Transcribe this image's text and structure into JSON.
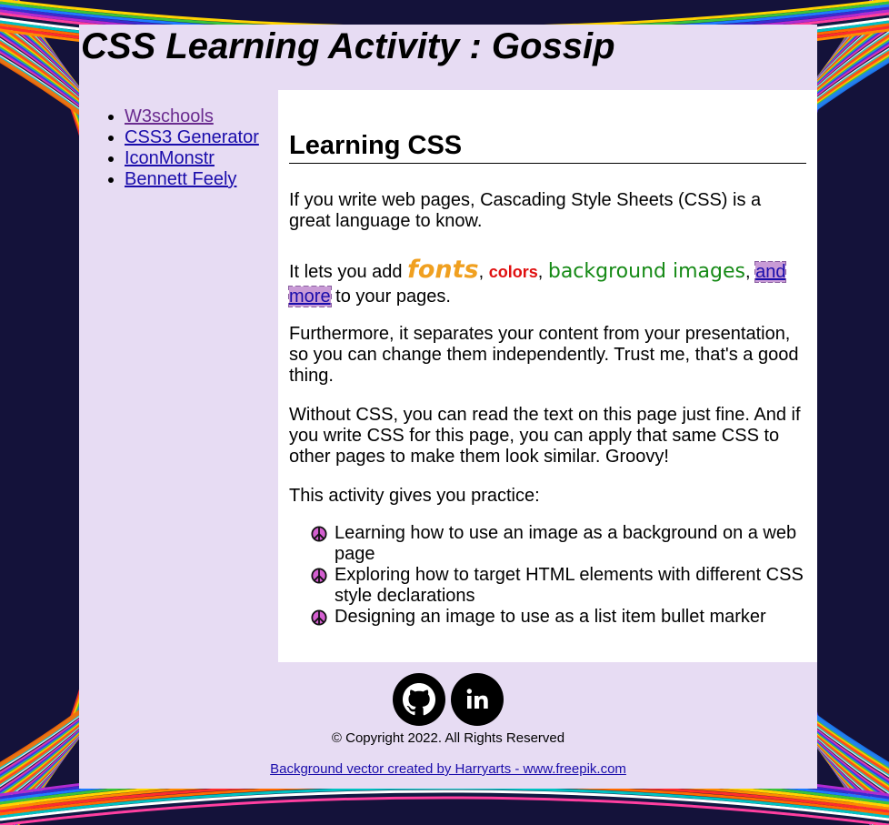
{
  "header": {
    "title": "CSS Learning Activity : Gossip"
  },
  "nav": {
    "items": [
      {
        "label": "W3schools"
      },
      {
        "label": "CSS3 Generator"
      },
      {
        "label": "IconMonstr"
      },
      {
        "label": "Bennett Feely"
      }
    ]
  },
  "main": {
    "heading": "Learning CSS",
    "p1": "If you write web pages, Cascading Style Sheets (CSS) is a great language to know.",
    "p2": {
      "lead": "It lets you add ",
      "fonts": "fonts",
      "sep1": ", ",
      "colors": "colors",
      "sep2": ", ",
      "background_images": "background images",
      "sep3": ", ",
      "link": "and more",
      "tail": " to your pages."
    },
    "p3": "Furthermore, it separates your content from your presentation, so you can change them independently. Trust me, that's a good thing.",
    "p4": "Without CSS, you can read the text on this page just fine. And if you write CSS for this page, you can apply that same CSS to other pages to make them look similar. Groovy!",
    "p5": "This activity gives you practice:",
    "bullets": [
      {
        "icon": "peace-sign-icon",
        "text": "Learning how to use an image as a background on a web page"
      },
      {
        "icon": "peace-sign-icon",
        "text": "Exploring how to target HTML elements with different CSS style declarations"
      },
      {
        "icon": "peace-sign-icon",
        "text": "Designing an image to use as a list item bullet marker"
      }
    ]
  },
  "footer": {
    "icons": [
      "github-icon",
      "linkedin-icon"
    ],
    "copyright": "© Copyright 2022. All Rights Reserved",
    "credit": "Background vector created by Harryarts - www.freepik.com"
  },
  "colors": {
    "container_bg": "#e7dcf3",
    "main_bg": "#ffffff",
    "link": "#1a0dab",
    "fonts_word": "#f0a020",
    "colors_word": "#e01010",
    "bg_images_word": "#168a16",
    "more_highlight": "#c99bd6"
  }
}
